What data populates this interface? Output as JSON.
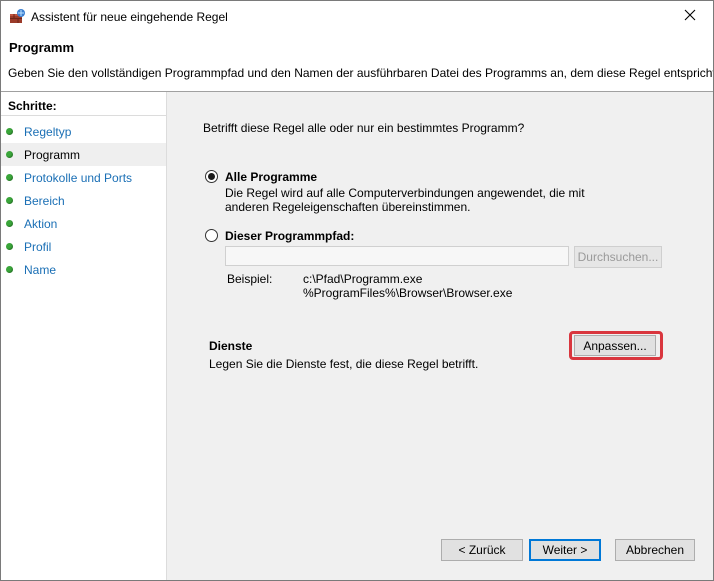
{
  "window": {
    "title": "Assistent für neue eingehende Regel"
  },
  "header": {
    "title": "Programm",
    "description": "Geben Sie den vollständigen Programmpfad und den Namen der ausführbaren Datei des Programms an, dem diese Regel entspricht."
  },
  "sidebar": {
    "title": "Schritte:",
    "steps": [
      {
        "label": "Regeltyp"
      },
      {
        "label": "Programm"
      },
      {
        "label": "Protokolle und Ports"
      },
      {
        "label": "Bereich"
      },
      {
        "label": "Aktion"
      },
      {
        "label": "Profil"
      },
      {
        "label": "Name"
      }
    ],
    "active_step": "Programm"
  },
  "main": {
    "question": "Betrifft diese Regel alle oder nur ein bestimmtes Programm?",
    "options": [
      {
        "label": "Alle Programme",
        "checked": true,
        "description": "Die Regel wird auf alle Computerverbindungen angewendet, die mit anderen Regeleigenschaften übereinstimmen."
      },
      {
        "label": "Dieser Programmpfad:",
        "checked": false,
        "path_value": "",
        "browse_label": "Durchsuchen...",
        "example_label": "Beispiel:",
        "example_line1": "c:\\Pfad\\Programm.exe",
        "example_line2": "%ProgramFiles%\\Browser\\Browser.exe"
      }
    ],
    "services": {
      "title": "Dienste",
      "description": "Legen Sie die Dienste fest, die diese Regel betrifft.",
      "customize_label": "Anpassen..."
    }
  },
  "footer": {
    "back_label": "< Zurück",
    "next_label": "Weiter >",
    "cancel_label": "Abbrechen"
  },
  "colors": {
    "step_link": "#1a6fb5",
    "step_dot": "#3aa63a",
    "highlight": "#d9363e",
    "primary_border": "#0078d7"
  }
}
